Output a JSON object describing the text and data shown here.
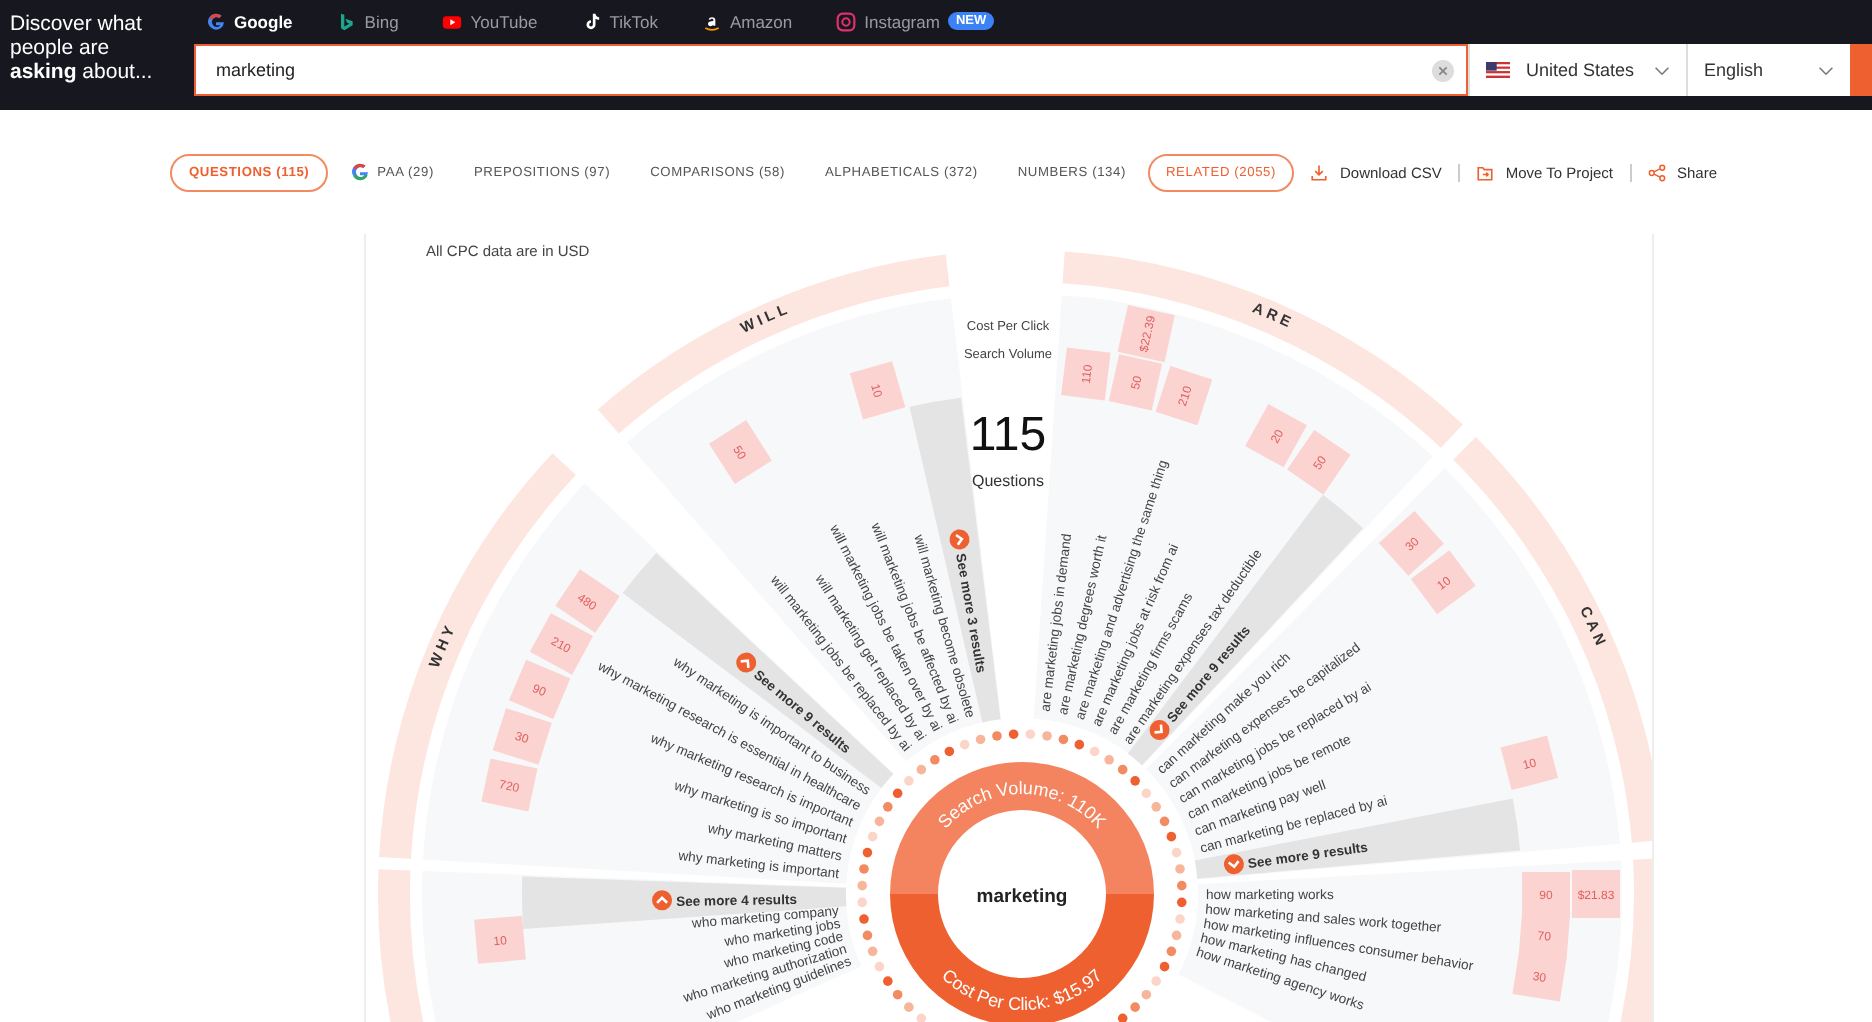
{
  "header": {
    "tagline": "Discover what people are **asking** about...",
    "engines": [
      {
        "label": "Google",
        "kind": "google",
        "selected": true
      },
      {
        "label": "Bing",
        "kind": "bing",
        "selected": false
      },
      {
        "label": "YouTube",
        "kind": "youtube",
        "selected": false
      },
      {
        "label": "TikTok",
        "kind": "tiktok",
        "selected": false
      },
      {
        "label": "Amazon",
        "kind": "amazon",
        "selected": false
      },
      {
        "label": "Instagram",
        "kind": "instagram",
        "selected": false,
        "badge": "NEW"
      }
    ],
    "search": {
      "value": "marketing"
    },
    "country": "United States",
    "language": "English"
  },
  "tabs": [
    {
      "label": "QUESTIONS (115)",
      "kind": "plain",
      "selected": true
    },
    {
      "label": "PAA (29)",
      "kind": "google",
      "selected": false
    },
    {
      "label": "PREPOSITIONS (97)",
      "kind": "plain",
      "selected": false
    },
    {
      "label": "COMPARISONS (58)",
      "kind": "plain",
      "selected": false
    },
    {
      "label": "ALPHABETICALS (372)",
      "kind": "plain",
      "selected": false
    },
    {
      "label": "NUMBERS (134)",
      "kind": "plain",
      "selected": false
    },
    {
      "label": "RELATED (2055)",
      "kind": "outlined",
      "selected": false
    }
  ],
  "actions": [
    {
      "label": "Download CSV",
      "kind": "download"
    },
    {
      "label": "Move To Project",
      "kind": "project"
    },
    {
      "label": "Share",
      "kind": "share"
    }
  ],
  "wheel": {
    "note": "All CPC data are in USD",
    "legend": [
      "Cost Per Click",
      "Search Volume"
    ],
    "count": "115",
    "count_label": "Questions",
    "keyword": "marketing",
    "search_volume": "Search Volume: 110K",
    "cpc": "Cost Per Click: $15.97",
    "groups": [
      {
        "see_more": "See more 4 results",
        "expanded": true,
        "questions": [
          {
            "text": "who marketing company",
            "volume": "10"
          },
          {
            "text": "who marketing jobs"
          },
          {
            "text": "who marketing code"
          },
          {
            "text": "who marketing authorization"
          },
          {
            "text": "who marketing guidelines"
          }
        ]
      },
      {
        "label": "WHY",
        "see_more": "See more 9 results",
        "expanded": true,
        "questions": [
          {
            "text": "why marketing is important to business",
            "volume": "480"
          },
          {
            "text": "why marketing research is essential in healthcare",
            "volume": "210"
          },
          {
            "text": "why marketing research is important",
            "volume": "90"
          },
          {
            "text": "why marketing is so important",
            "volume": "30"
          },
          {
            "text": "why marketing matters",
            "volume": "720"
          },
          {
            "text": "why marketing is important"
          }
        ]
      },
      {
        "label": "WILL",
        "see_more": "See more 3 results",
        "expanded": true,
        "questions": [
          {
            "text": "will marketing become obsolete",
            "volume": "10"
          },
          {
            "text": "will marketing jobs be affected by ai"
          },
          {
            "text": "will marketing jobs be taken over by ai"
          },
          {
            "text": "will marketing get replaced by ai",
            "volume": "50"
          },
          {
            "text": "will marketing jobs be replaced by ai"
          }
        ]
      },
      {
        "label": "ARE",
        "see_more": "See more 9 results",
        "expanded": false,
        "questions": [
          {
            "text": "are marketing jobs in demand",
            "volume": "110"
          },
          {
            "text": "are marketing degrees worth it",
            "volume": "50",
            "cpc": "$22.39"
          },
          {
            "text": "are marketing and advertising the same thing",
            "volume": "210"
          },
          {
            "text": "are marketing jobs at risk from ai"
          },
          {
            "text": "are marketing firms scams",
            "volume": "20"
          },
          {
            "text": "are marketing expenses tax deductible",
            "volume": "50"
          }
        ]
      },
      {
        "label": "CAN",
        "see_more": "See more 9 results",
        "expanded": false,
        "questions": [
          {
            "text": "can marketing make you rich",
            "volume": "30"
          },
          {
            "text": "can marketing expenses be capitalized",
            "volume": "10"
          },
          {
            "text": "can marketing jobs be replaced by ai"
          },
          {
            "text": "can marketing jobs be remote"
          },
          {
            "text": "can marketing pay well"
          },
          {
            "text": "can marketing be replaced by ai",
            "volume": "10"
          }
        ]
      },
      {
        "questions": [
          {
            "text": "how marketing works",
            "volume": "90",
            "cpc": "$21.83"
          },
          {
            "text": "how marketing and sales work together",
            "volume": "70"
          },
          {
            "text": "how marketing influences consumer behavior",
            "volume": "30"
          },
          {
            "text": "how marketing has changed"
          },
          {
            "text": "how marketing agency works"
          }
        ]
      }
    ]
  }
}
